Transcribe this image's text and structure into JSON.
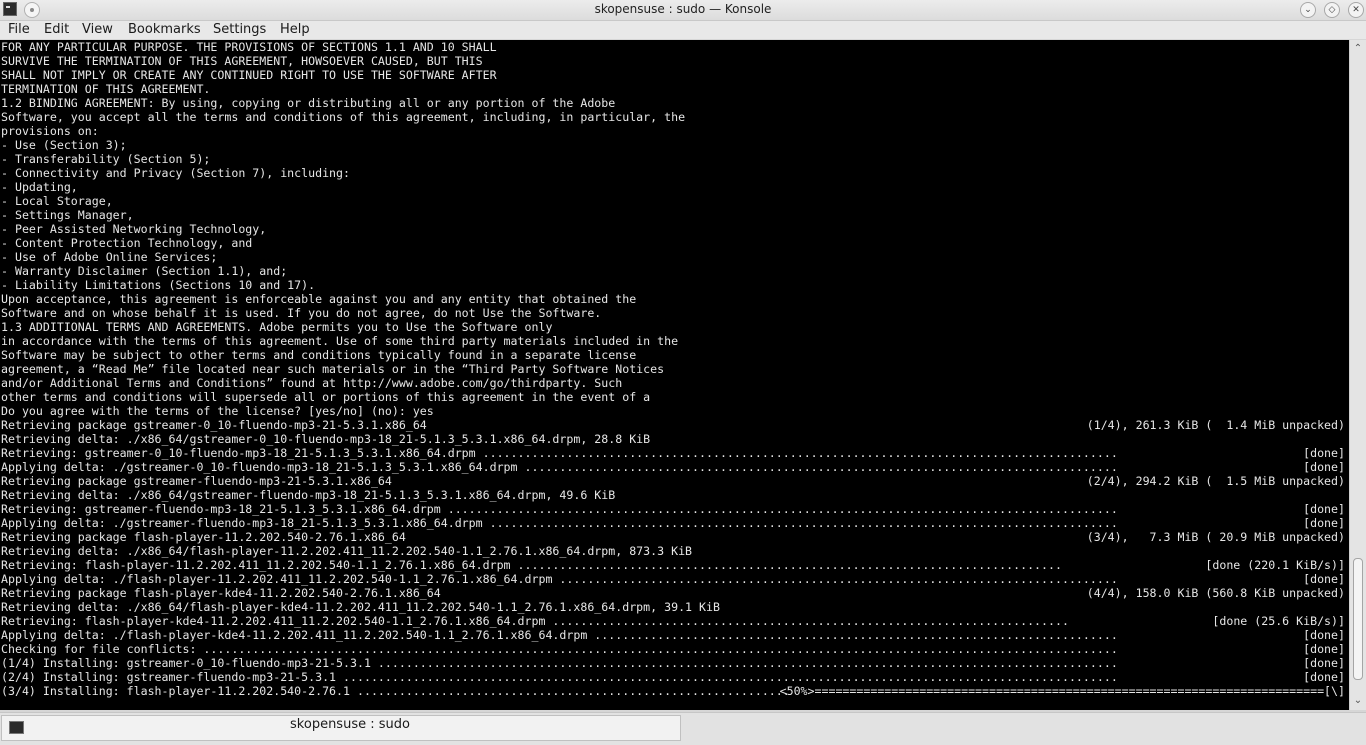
{
  "window": {
    "title": "skopensuse : sudo — Konsole"
  },
  "menubar": [
    "File",
    "Edit",
    "View",
    "Bookmarks",
    "Settings",
    "Help"
  ],
  "terminal": {
    "lines": [
      "FOR ANY PARTICULAR PURPOSE. THE PROVISIONS OF SECTIONS 1.1 AND 10 SHALL",
      "SURVIVE THE TERMINATION OF THIS AGREEMENT, HOWSOEVER CAUSED, BUT THIS",
      "SHALL NOT IMPLY OR CREATE ANY CONTINUED RIGHT TO USE THE SOFTWARE AFTER",
      "TERMINATION OF THIS AGREEMENT.",
      "1.2 BINDING AGREEMENT: By using, copying or distributing all or any portion of the Adobe",
      "Software, you accept all the terms and conditions of this agreement, including, in particular, the",
      "provisions on:",
      "- Use (Section 3);",
      "- Transferability (Section 5);",
      "- Connectivity and Privacy (Section 7), including:",
      "- Updating,",
      "- Local Storage,",
      "- Settings Manager,",
      "- Peer Assisted Networking Technology,",
      "- Content Protection Technology, and",
      "- Use of Adobe Online Services;",
      "- Warranty Disclaimer (Section 1.1), and;",
      "- Liability Limitations (Sections 10 and 17).",
      "Upon acceptance, this agreement is enforceable against you and any entity that obtained the",
      "Software and on whose behalf it is used. If you do not agree, do not Use the Software.",
      "1.3 ADDITIONAL TERMS AND AGREEMENTS. Adobe permits you to Use the Software only",
      "in accordance with the terms of this agreement. Use of some third party materials included in the",
      "Software may be subject to other terms and conditions typically found in a separate license",
      "agreement, a “Read Me” file located near such materials or in the “Third Party Software Notices",
      "and/or Additional Terms and Conditions” found at http://www.adobe.com/go/thirdparty. Such",
      "other terms and conditions will supersede all or portions of this agreement in the event of a",
      "Do you agree with the terms of the license? [yes/no] (no): yes",
      "Retrieving package gstreamer-0_10-fluendo-mp3-21-5.3.1.x86_64",
      "Retrieving delta: ./x86_64/gstreamer-0_10-fluendo-mp3-18_21-5.1.3_5.3.1.x86_64.drpm, 28.8 KiB",
      "Retrieving: gstreamer-0_10-fluendo-mp3-18_21-5.1.3_5.3.1.x86_64.drpm ...........................................................................................",
      "Applying delta: ./gstreamer-0_10-fluendo-mp3-18_21-5.1.3_5.3.1.x86_64.drpm .....................................................................................",
      "Retrieving package gstreamer-fluendo-mp3-21-5.3.1.x86_64",
      "Retrieving delta: ./x86_64/gstreamer-fluendo-mp3-18_21-5.1.3_5.3.1.x86_64.drpm, 49.6 KiB",
      "Retrieving: gstreamer-fluendo-mp3-18_21-5.1.3_5.3.1.x86_64.drpm ................................................................................................",
      "Applying delta: ./gstreamer-fluendo-mp3-18_21-5.1.3_5.3.1.x86_64.drpm ..........................................................................................",
      "Retrieving package flash-player-11.2.202.540-2.76.1.x86_64",
      "Retrieving delta: ./x86_64/flash-player-11.2.202.411_11.2.202.540-1.1_2.76.1.x86_64.drpm, 873.3 KiB",
      "Retrieving: flash-player-11.2.202.411_11.2.202.540-1.1_2.76.1.x86_64.drpm ..............................................................................",
      "Applying delta: ./flash-player-11.2.202.411_11.2.202.540-1.1_2.76.1.x86_64.drpm ................................................................................",
      "Retrieving package flash-player-kde4-11.2.202.540-2.76.1.x86_64",
      "Retrieving delta: ./x86_64/flash-player-kde4-11.2.202.411_11.2.202.540-1.1_2.76.1.x86_64.drpm, 39.1 KiB",
      "Retrieving: flash-player-kde4-11.2.202.411_11.2.202.540-1.1_2.76.1.x86_64.drpm ..........................................................................",
      "Applying delta: ./flash-player-kde4-11.2.202.411_11.2.202.540-1.1_2.76.1.x86_64.drpm ...........................................................................",
      "Checking for file conflicts: ...................................................................................................................................",
      "(1/4) Installing: gstreamer-0_10-fluendo-mp3-21-5.3.1 ..........................................................................................................",
      "(2/4) Installing: gstreamer-fluendo-mp3-21-5.3.1 ...............................................................................................................",
      "(3/4) Installing: flash-player-11.2.202.540-2.76.1 .............................................................."
    ],
    "right_status": [
      {
        "line": 27,
        "text": "(1/4), 261.3 KiB (  1.4 MiB unpacked)"
      },
      {
        "line": 29,
        "text": "[done]"
      },
      {
        "line": 30,
        "text": "[done]"
      },
      {
        "line": 31,
        "text": "(2/4), 294.2 KiB (  1.5 MiB unpacked)"
      },
      {
        "line": 33,
        "text": "[done]"
      },
      {
        "line": 34,
        "text": "[done]"
      },
      {
        "line": 35,
        "text": "(3/4),   7.3 MiB ( 20.9 MiB unpacked)"
      },
      {
        "line": 37,
        "text": "[done (220.1 KiB/s)]"
      },
      {
        "line": 38,
        "text": "[done]"
      },
      {
        "line": 39,
        "text": "(4/4), 158.0 KiB (560.8 KiB unpacked)"
      },
      {
        "line": 41,
        "text": "[done (25.6 KiB/s)]"
      },
      {
        "line": 42,
        "text": "[done]"
      },
      {
        "line": 43,
        "text": "[done]"
      },
      {
        "line": 44,
        "text": "[done]"
      },
      {
        "line": 45,
        "text": "[done]"
      },
      {
        "line": 46,
        "text": "<50%>=========================================================================[\\]"
      }
    ]
  },
  "taskbar": {
    "task_label": "skopensuse : sudo"
  },
  "icons": {
    "app": "terminal-icon",
    "pin": "pin-icon",
    "minimize": "minimize-icon",
    "maximize": "maximize-icon",
    "close": "close-icon",
    "scroll_up": "scroll-up-icon",
    "scroll_down": "scroll-down-icon"
  },
  "glyphs": {
    "minimize": "⌄",
    "maximize": "◇",
    "close": "✕",
    "up": "⌃",
    "down": "⌄"
  }
}
